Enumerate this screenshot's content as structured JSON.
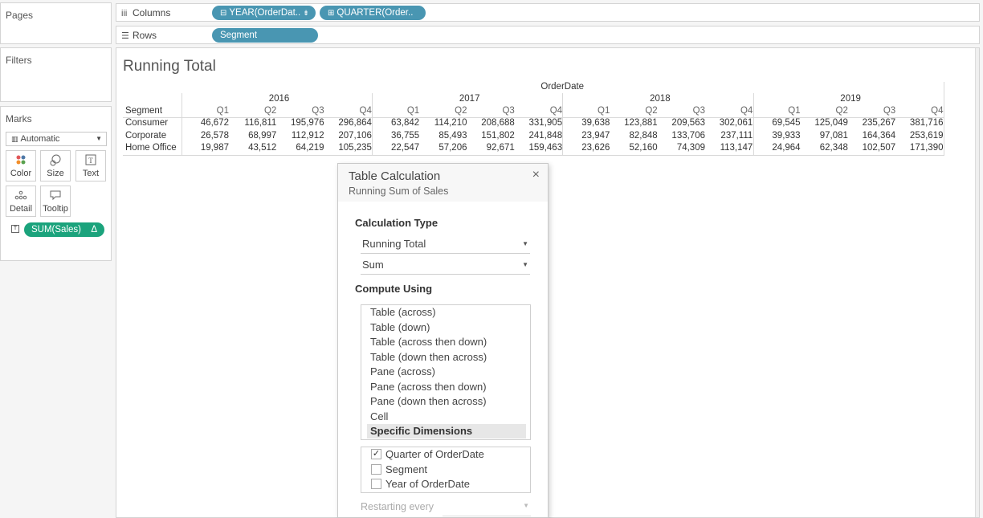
{
  "cards": {
    "pages_title": "Pages",
    "filters_title": "Filters",
    "marks_title": "Marks"
  },
  "shelves": {
    "columns_label": "Columns",
    "rows_label": "Rows",
    "columns_pills": [
      "YEAR(OrderDat..",
      "QUARTER(Order.."
    ],
    "rows_pills": [
      "Segment"
    ]
  },
  "marks": {
    "type_dropdown": "Automatic",
    "buttons": [
      "Color",
      "Size",
      "Text",
      "Detail",
      "Tooltip"
    ],
    "measure_pill": "SUM(Sales)",
    "delta_symbol": "Δ"
  },
  "view": {
    "title": "Running Total",
    "header_top": "OrderDate",
    "row_header": "Segment",
    "years": [
      "2016",
      "2017",
      "2018",
      "2019"
    ],
    "quarters": [
      "Q1",
      "Q2",
      "Q3",
      "Q4"
    ],
    "rows": [
      {
        "segment": "Consumer",
        "values": [
          "46,672",
          "116,811",
          "195,976",
          "296,864",
          "63,842",
          "114,210",
          "208,688",
          "331,905",
          "39,638",
          "123,881",
          "209,563",
          "302,061",
          "69,545",
          "125,049",
          "235,267",
          "381,716"
        ]
      },
      {
        "segment": "Corporate",
        "values": [
          "26,578",
          "68,997",
          "112,912",
          "207,106",
          "36,755",
          "85,493",
          "151,802",
          "241,848",
          "23,947",
          "82,848",
          "133,706",
          "237,111",
          "39,933",
          "97,081",
          "164,364",
          "253,619"
        ]
      },
      {
        "segment": "Home Office",
        "values": [
          "19,987",
          "43,512",
          "64,219",
          "105,235",
          "22,547",
          "57,206",
          "92,671",
          "159,463",
          "23,626",
          "52,160",
          "74,309",
          "113,147",
          "24,964",
          "62,348",
          "102,507",
          "171,390"
        ]
      }
    ]
  },
  "dialog": {
    "title": "Table Calculation",
    "subtitle": "Running Sum of Sales",
    "close_glyph": "×",
    "calc_type_label": "Calculation Type",
    "calc_type_value": "Running Total",
    "aggregation_value": "Sum",
    "compute_using_label": "Compute Using",
    "compute_options": [
      "Table (across)",
      "Table (down)",
      "Table (across then down)",
      "Table (down then across)",
      "Pane (across)",
      "Pane (across then down)",
      "Pane (down then across)",
      "Cell",
      "Specific Dimensions"
    ],
    "selected_option": "Specific Dimensions",
    "dimensions": [
      {
        "label": "Quarter of OrderDate",
        "checked": true
      },
      {
        "label": "Segment",
        "checked": false
      },
      {
        "label": "Year of OrderDate",
        "checked": false
      }
    ],
    "restarting_label": "Restarting every"
  }
}
